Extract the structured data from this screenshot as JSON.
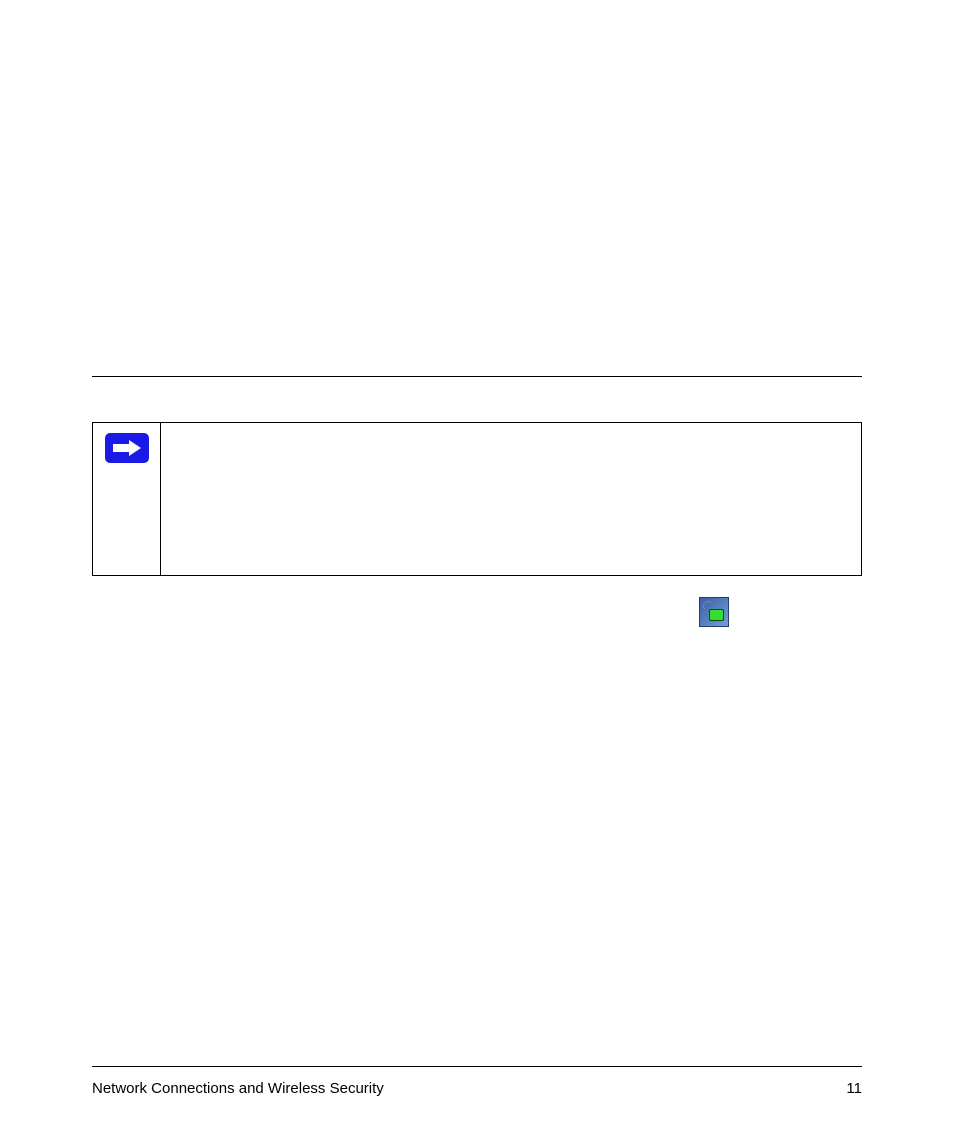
{
  "footer": {
    "section_title": "Network Connections and Wireless Security",
    "page_number": "11"
  },
  "icons": {
    "note_arrow": "arrow-right-icon",
    "systray": "smart-wizard-tray-icon"
  }
}
